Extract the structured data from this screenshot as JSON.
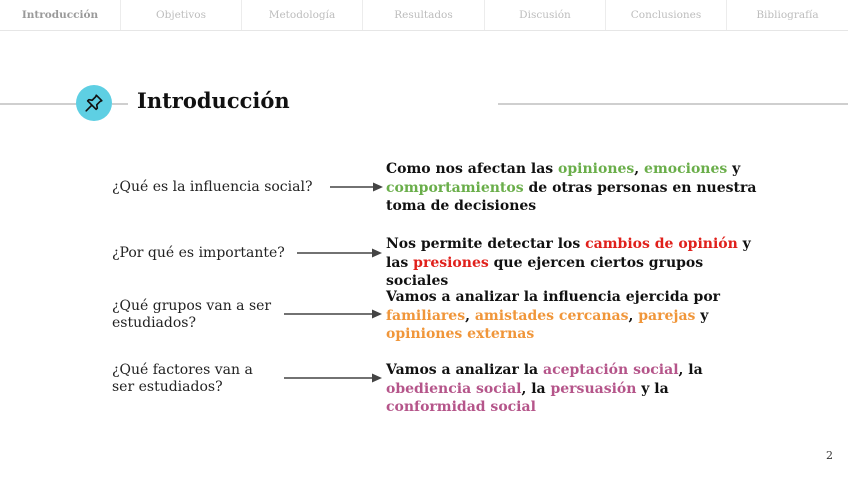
{
  "nav": {
    "tabs": [
      {
        "label": "Introducción",
        "active": true
      },
      {
        "label": "Objetivos",
        "active": false
      },
      {
        "label": "Metodología",
        "active": false
      },
      {
        "label": "Resultados",
        "active": false
      },
      {
        "label": "Discusión",
        "active": false
      },
      {
        "label": "Conclusiones",
        "active": false
      },
      {
        "label": "Bibliografía",
        "active": false
      }
    ]
  },
  "header": {
    "title": "Introducción",
    "icon": "pushpin-icon",
    "badge_color": "#5ecfe3"
  },
  "items": [
    {
      "question": "¿Qué es la influencia social?",
      "answer": [
        {
          "t": "Como nos afectan las "
        },
        {
          "t": "opiniones",
          "c": "green"
        },
        {
          "t": ", "
        },
        {
          "t": "emociones",
          "c": "green"
        },
        {
          "t": " y "
        },
        {
          "t": "comportamientos",
          "c": "green"
        },
        {
          "t": " de otras personas en nuestra toma de decisiones"
        }
      ]
    },
    {
      "question": "¿Por qué es importante?",
      "answer": [
        {
          "t": "Nos permite detectar los "
        },
        {
          "t": "cambios de opinión",
          "c": "red"
        },
        {
          "t": " y las "
        },
        {
          "t": "presiones",
          "c": "red"
        },
        {
          "t": " que ejercen ciertos grupos sociales"
        }
      ]
    },
    {
      "question": "¿Qué grupos van a ser estudiados?",
      "answer": [
        {
          "t": "Vamos a analizar la influencia ejercida por "
        },
        {
          "t": "familiares",
          "c": "orange"
        },
        {
          "t": ", "
        },
        {
          "t": "amistades cercanas",
          "c": "orange"
        },
        {
          "t": ", "
        },
        {
          "t": "parejas",
          "c": "orange"
        },
        {
          "t": " y "
        },
        {
          "t": "opiniones externas",
          "c": "orange"
        }
      ]
    },
    {
      "question": "¿Qué factores van a ser estudiados?",
      "answer": [
        {
          "t": "Vamos a analizar la "
        },
        {
          "t": "aceptación social",
          "c": "purple"
        },
        {
          "t": ", la "
        },
        {
          "t": "obediencia social",
          "c": "purple"
        },
        {
          "t": ", la "
        },
        {
          "t": "persuasión",
          "c": "purple"
        },
        {
          "t": " y la "
        },
        {
          "t": "conformidad social",
          "c": "purple"
        }
      ]
    }
  ],
  "colors": {
    "green": "#6aae4a",
    "red": "#e0201b",
    "orange": "#f0963a",
    "purple": "#b5558a"
  },
  "page_number": "2"
}
